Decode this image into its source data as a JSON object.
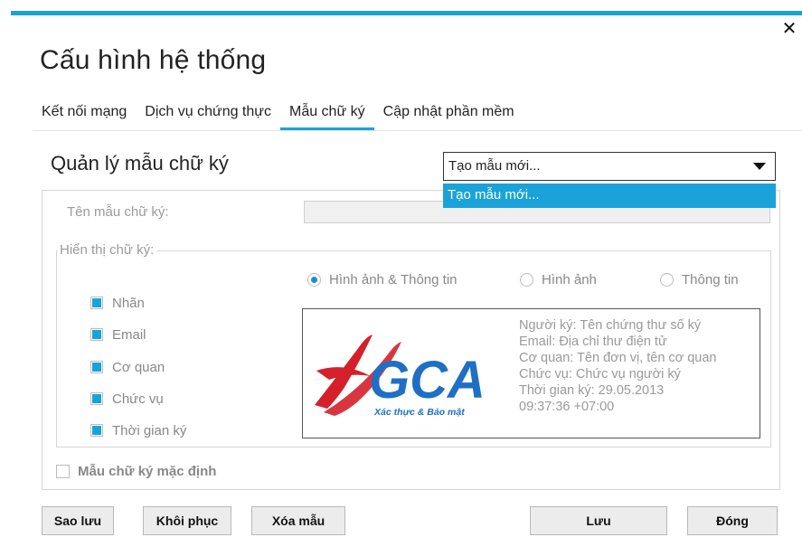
{
  "dialog": {
    "title": "Cấu hình hệ thống",
    "close_label": "✕"
  },
  "tabs": [
    {
      "label": "Kết nối mạng",
      "active": false
    },
    {
      "label": "Dịch vụ chứng thực",
      "active": false
    },
    {
      "label": "Mẫu chữ ký",
      "active": true
    },
    {
      "label": "Cập nhật phần mềm",
      "active": false
    }
  ],
  "section": {
    "title": "Quản lý mẫu chữ ký"
  },
  "template_select": {
    "value": "Tạo mẫu mới...",
    "options": [
      "Tạo mẫu mới..."
    ]
  },
  "form": {
    "name_label": "Tên mẫu chữ ký:",
    "display_legend": "Hiển thị chữ ký:",
    "checkboxes": [
      {
        "label": "Nhãn",
        "checked": true
      },
      {
        "label": "Email",
        "checked": true
      },
      {
        "label": "Cơ quan",
        "checked": true
      },
      {
        "label": "Chức vụ",
        "checked": true
      },
      {
        "label": "Thời gian ký",
        "checked": true
      }
    ],
    "radios": [
      {
        "label": "Hình ảnh & Thông tin",
        "selected": true
      },
      {
        "label": "Hình ảnh",
        "selected": false
      },
      {
        "label": "Thông tin",
        "selected": false
      }
    ],
    "default_label": "Mẫu chữ ký mặc định",
    "default_checked": false
  },
  "preview": {
    "logo_text": "GCA",
    "logo_tagline": "Xác thực & Bảo mật",
    "lines": [
      "Người ký: Tên chứng thư số ký",
      "Email: Địa chỉ thư điện tử",
      "Cơ quan: Tên đơn vị, tên cơ quan",
      "Chức vụ: Chức vụ người ký",
      "Thời gian ký: 29.05.2013",
      "09:37:36 +07:00"
    ]
  },
  "buttons": {
    "backup": "Sao lưu",
    "restore": "Khôi phục",
    "delete": "Xóa mẫu",
    "save": "Lưu",
    "close": "Đóng"
  },
  "colors": {
    "accent": "#1aa3d9",
    "logo_blue": "#1f6fc4",
    "logo_red": "#d4202a"
  }
}
